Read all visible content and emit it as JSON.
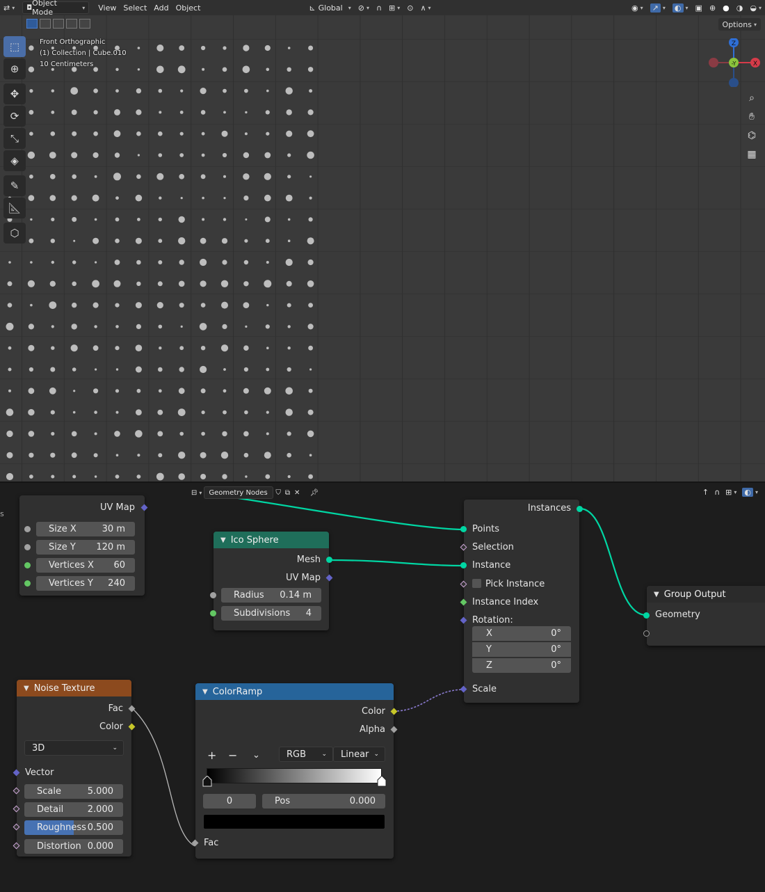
{
  "header": {
    "mode": "Object Mode",
    "menus": [
      "View",
      "Select",
      "Add",
      "Object"
    ],
    "transform_orientation": "Global",
    "options": "Options"
  },
  "viewport": {
    "view_name": "Front Orthographic",
    "collection": "(1) Collection | Cube.010",
    "scale": "10 Centimeters",
    "gizmo": {
      "z": "Z",
      "y": "-Y",
      "x": "X"
    }
  },
  "node_editor": {
    "tree_name": "Geometry Nodes"
  },
  "nodes": {
    "grid": {
      "uvmap": "UV Map",
      "size_x_label": "Size X",
      "size_x_value": "30 m",
      "size_y_label": "Size Y",
      "size_y_value": "120 m",
      "verts_x_label": "Vertices X",
      "verts_x_value": "60",
      "verts_y_label": "Vertices Y",
      "verts_y_value": "240"
    },
    "ico": {
      "title": "Ico Sphere",
      "mesh": "Mesh",
      "uvmap": "UV Map",
      "radius_label": "Radius",
      "radius_value": "0.14 m",
      "subdiv_label": "Subdivisions",
      "subdiv_value": "4"
    },
    "instance": {
      "instances": "Instances",
      "points": "Points",
      "selection": "Selection",
      "instance": "Instance",
      "pick_instance": "Pick Instance",
      "instance_index": "Instance Index",
      "rotation": "Rotation:",
      "rx_label": "X",
      "rx_value": "0°",
      "ry_label": "Y",
      "ry_value": "0°",
      "rz_label": "Z",
      "rz_value": "0°",
      "scale": "Scale"
    },
    "output": {
      "title": "Group Output",
      "geometry": "Geometry"
    },
    "noise": {
      "title": "Noise Texture",
      "fac": "Fac",
      "color": "Color",
      "dimensions": "3D",
      "vector": "Vector",
      "scale_label": "Scale",
      "scale_value": "5.000",
      "detail_label": "Detail",
      "detail_value": "2.000",
      "rough_label": "Roughness",
      "rough_value": "0.500",
      "rough_fraction": 0.5,
      "distort_label": "Distortion",
      "distort_value": "0.000"
    },
    "ramp": {
      "title": "ColorRamp",
      "color": "Color",
      "alpha": "Alpha",
      "plus": "+",
      "minus": "−",
      "color_mode": "RGB",
      "interpolation": "Linear",
      "index": "0",
      "pos_label": "Pos",
      "pos_value": "0.000",
      "fac": "Fac"
    }
  },
  "colors": {
    "geometry_socket": "#00d6a3",
    "float_socket": "#a1a1a1",
    "vector_socket": "#6363c7",
    "color_socket": "#c7c729",
    "int_socket": "#63c763"
  }
}
